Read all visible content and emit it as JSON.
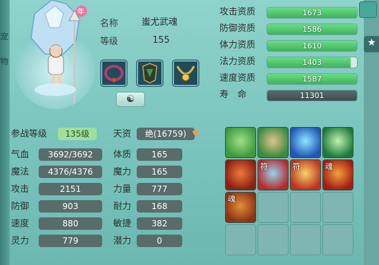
{
  "left_tabs": [
    "宠",
    "物"
  ],
  "pet": {
    "name_label": "名称",
    "name_value": "蚩尤武魂",
    "level_label": "等级",
    "level_value": "155",
    "badge_text": "年"
  },
  "equipment": [
    "collar",
    "armor",
    "necklace"
  ],
  "yinyang_icon": "yin-yang",
  "aptitudes": [
    {
      "label": "攻击资质",
      "value": "1673",
      "fill": 1.0
    },
    {
      "label": "防御资质",
      "value": "1586",
      "fill": 1.0
    },
    {
      "label": "体力资质",
      "value": "1610",
      "fill": 1.0
    },
    {
      "label": "法力资质",
      "value": "1403",
      "fill": 0.93
    },
    {
      "label": "速度资质",
      "value": "1587",
      "fill": 1.0
    },
    {
      "label": "寿　命",
      "value": "11301",
      "fill": 1.0
    }
  ],
  "stats": {
    "battle_level_label": "参战等级",
    "battle_level_value": "135级",
    "talent_label": "天资",
    "talent_value": "绝(16759)",
    "hp_label": "气血",
    "hp_value": "3692/3692",
    "mp_label": "魔法",
    "mp_value": "4376/4376",
    "atk_label": "攻击",
    "atk_value": "2151",
    "def_label": "防御",
    "def_value": "903",
    "spd_label": "速度",
    "spd_value": "880",
    "spirit_label": "灵力",
    "spirit_value": "779",
    "con_label": "体质",
    "con_value": "165",
    "mag_label": "魔力",
    "mag_value": "165",
    "str_label": "力量",
    "str_value": "777",
    "end_label": "耐力",
    "end_value": "168",
    "agi_label": "敏捷",
    "agi_value": "382",
    "pot_label": "潜力",
    "pot_value": "0"
  },
  "skills": [
    {
      "icon": "green-figure-skill-icon",
      "colors": [
        "#3f9a3a",
        "#9be08c"
      ],
      "label": ""
    },
    {
      "icon": "scroll-skill-icon",
      "colors": [
        "#3a8a3f",
        "#e2c48c"
      ],
      "label": ""
    },
    {
      "icon": "blue-burst-skill-icon",
      "colors": [
        "#1e56b8",
        "#8fe6ff"
      ],
      "label": ""
    },
    {
      "icon": "green-hand-skill-icon",
      "colors": [
        "#1c7a3b",
        "#c2f2b0"
      ],
      "label": ""
    },
    {
      "icon": "red-slash-skill-icon",
      "colors": [
        "#8a1f13",
        "#f07a3a"
      ],
      "label": ""
    },
    {
      "icon": "talisman-skill-icon",
      "colors": [
        "#b8292b",
        "#8fd8f0"
      ],
      "label": "符"
    },
    {
      "icon": "talisman-fire-skill-icon",
      "colors": [
        "#c0321e",
        "#f2d46b"
      ],
      "label": "符"
    },
    {
      "icon": "soul-burst-skill-icon",
      "colors": [
        "#a31d14",
        "#f2a23a"
      ],
      "label": "魂"
    },
    {
      "icon": "soul-warrior-skill-icon",
      "colors": [
        "#8b3313",
        "#e38d3c"
      ],
      "label": "魂"
    }
  ],
  "empty_slots": 7
}
